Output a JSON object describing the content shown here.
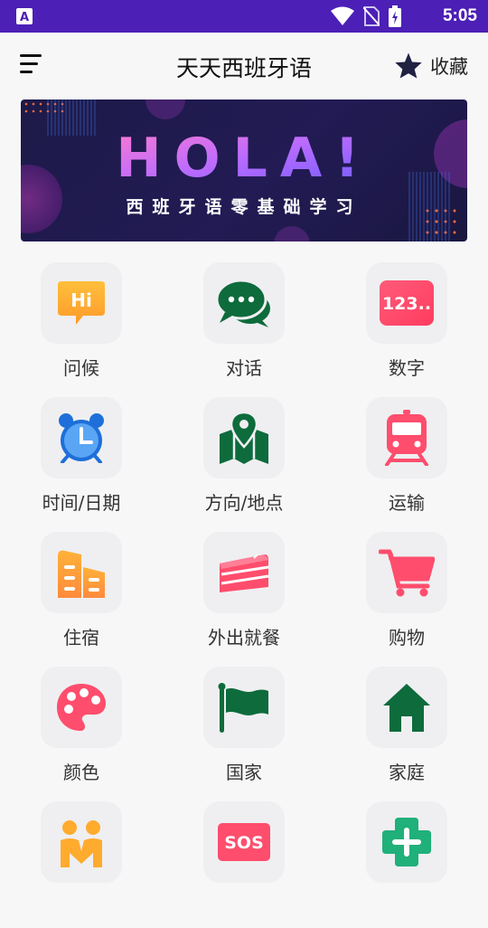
{
  "status_bar": {
    "time": "5:05"
  },
  "app_bar": {
    "title": "天天西班牙语",
    "favorite_label": "收藏"
  },
  "banner": {
    "headline": "HOLA!",
    "subtitle": "西班牙语零基础学习"
  },
  "categories": [
    {
      "label": "问候",
      "icon": "hi-speech-bubble-icon"
    },
    {
      "label": "对话",
      "icon": "chat-bubbles-icon"
    },
    {
      "label": "数字",
      "icon": "numbers-123-icon"
    },
    {
      "label": "时间/日期",
      "icon": "alarm-clock-icon"
    },
    {
      "label": "方向/地点",
      "icon": "map-pin-icon"
    },
    {
      "label": "运输",
      "icon": "train-icon"
    },
    {
      "label": "住宿",
      "icon": "building-icon"
    },
    {
      "label": "外出就餐",
      "icon": "cake-icon"
    },
    {
      "label": "购物",
      "icon": "shopping-cart-icon"
    },
    {
      "label": "颜色",
      "icon": "palette-icon"
    },
    {
      "label": "国家",
      "icon": "flag-icon"
    },
    {
      "label": "家庭",
      "icon": "house-icon"
    },
    {
      "label": "",
      "icon": "family-people-icon"
    },
    {
      "label": "",
      "icon": "sos-icon"
    },
    {
      "label": "",
      "icon": "health-cross-icon"
    }
  ],
  "colors": {
    "status_bar": "#4c1fb6",
    "green": "#0d6b3c",
    "pink": "#ff4d6d",
    "orange": "#ffab2e",
    "blue": "#3d8ef0"
  }
}
